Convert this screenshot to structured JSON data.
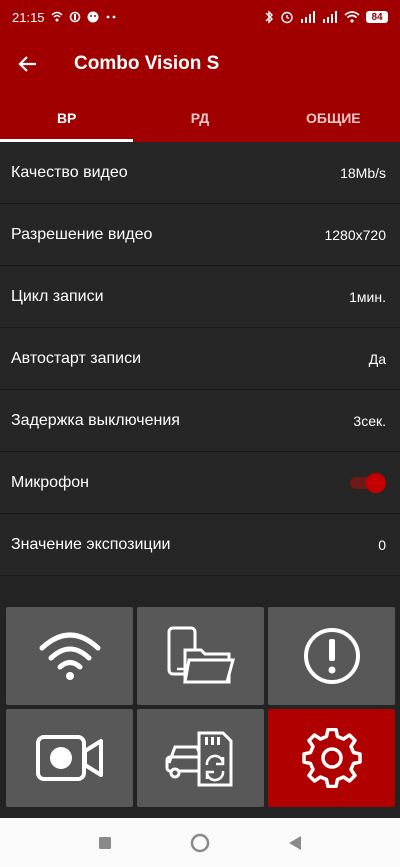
{
  "status_bar": {
    "time": "21:15",
    "battery": "84",
    "left_icons": [
      "wifi-calling-icon",
      "data-saver-icon",
      "face-icon",
      "more-dots-icon"
    ],
    "right_icons": [
      "bluetooth-icon",
      "alarm-icon",
      "signal-icon",
      "signal-icon-2",
      "wifi-icon",
      "battery-icon"
    ]
  },
  "app_bar": {
    "title": "Combo Vision S",
    "back_icon": "arrow-back-icon"
  },
  "tabs": [
    {
      "label": "ВР",
      "active": true
    },
    {
      "label": "РД",
      "active": false
    },
    {
      "label": "ОБЩИЕ",
      "active": false
    }
  ],
  "settings": [
    {
      "label": "Качество видео",
      "value": "18Mb/s"
    },
    {
      "label": "Разрешение видео",
      "value": "1280x720"
    },
    {
      "label": "Цикл записи",
      "value": "1мин."
    },
    {
      "label": "Автостарт записи",
      "value": "Да"
    },
    {
      "label": "Задержка выключения",
      "value": "3сек."
    },
    {
      "label": "Микрофон",
      "toggle": true
    },
    {
      "label": "Значение экспозиции",
      "value": "0"
    }
  ],
  "tiles": [
    {
      "icon": "wifi-icon",
      "active": false
    },
    {
      "icon": "files-icon",
      "active": false
    },
    {
      "icon": "alert-icon",
      "active": false
    },
    {
      "icon": "video-camera-icon",
      "active": false
    },
    {
      "icon": "sd-card-sync-icon",
      "active": false
    },
    {
      "icon": "gear-icon",
      "active": true
    }
  ],
  "colors": {
    "accent": "#a10000",
    "background": "#262626",
    "tile": "#585858",
    "tile_active": "#b10000"
  }
}
